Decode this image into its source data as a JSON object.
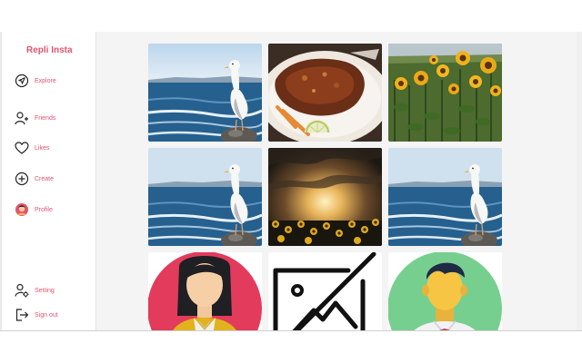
{
  "app": {
    "brand": "Repli Insta"
  },
  "sidebar": {
    "items": [
      {
        "label": "Explore",
        "icon": "explore-icon"
      },
      {
        "label": "Friends",
        "icon": "add-friend-icon"
      },
      {
        "label": "Likes",
        "icon": "heart-icon"
      },
      {
        "label": "Create",
        "icon": "plus-circle-icon"
      },
      {
        "label": "Profile",
        "icon": "profile-avatar"
      }
    ],
    "bottom_items": [
      {
        "label": "Setting",
        "icon": "user-settings-icon"
      },
      {
        "label": "Sign out",
        "icon": "sign-out-icon"
      }
    ]
  },
  "colors": {
    "accent": "#e05570",
    "sidebar_bg": "#ffffff",
    "content_bg": "#f4f4f4"
  },
  "feed": {
    "tiles": [
      {
        "image": "seagull-on-rock-by-sea"
      },
      {
        "image": "grilled-meat-plate-with-lemon"
      },
      {
        "image": "sunflower-field"
      },
      {
        "image": "seagull-on-rock-by-sea"
      },
      {
        "image": "sunset-over-sunflowers"
      },
      {
        "image": "seagull-on-rock-by-sea"
      },
      {
        "image": "woman-avatar-illustration"
      },
      {
        "image": "broken-image-placeholder"
      },
      {
        "image": "man-avatar-illustration"
      }
    ]
  }
}
